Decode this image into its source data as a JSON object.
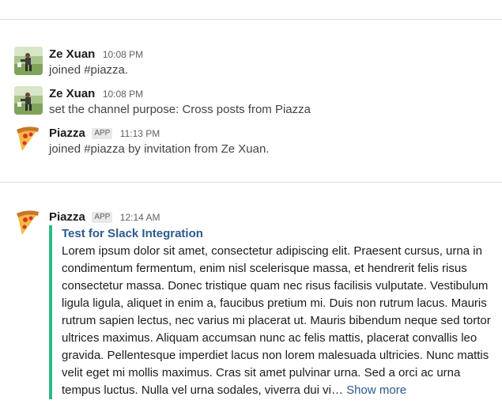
{
  "messages": [
    {
      "author": "Ze Xuan",
      "time": "10:08 PM",
      "text": "joined #piazza."
    },
    {
      "author": "Ze Xuan",
      "time": "10:08 PM",
      "text": "set the channel purpose: Cross posts from Piazza"
    },
    {
      "author": "Piazza",
      "badge": "APP",
      "time": "11:13 PM",
      "text": "joined #piazza by invitation from Ze Xuan."
    }
  ],
  "attachment_message": {
    "author": "Piazza",
    "badge": "APP",
    "time": "12:14 AM",
    "title": "Test for Slack Integration",
    "body": "Lorem ipsum dolor sit amet, consectetur adipiscing elit. Praesent cursus, urna in condimentum fermentum, enim nisl scelerisque massa, et hendrerit felis risus consectetur massa. Donec tristique quam nec risus facilisis vulputate. Vestibulum ligula ligula, aliquet in enim a, faucibus pretium mi. Duis non rutrum lacus. Mauris rutrum sapien lectus, nec varius mi placerat ut. Mauris bibendum neque sed tortor ultrices maximus. Aliquam accumsan nunc ac felis mattis, placerat convallis leo gravida. Pellentesque imperdiet lacus non lorem malesuada ultricies. Nunc mattis velit eget mi mollis maximus. Cras sit amet pulvinar urna. Sed a orci ac urna tempus luctus. Nulla vel urna sodales, viverra dui vi…",
    "show_more": "Show more",
    "accent_color": "#2eb886"
  }
}
